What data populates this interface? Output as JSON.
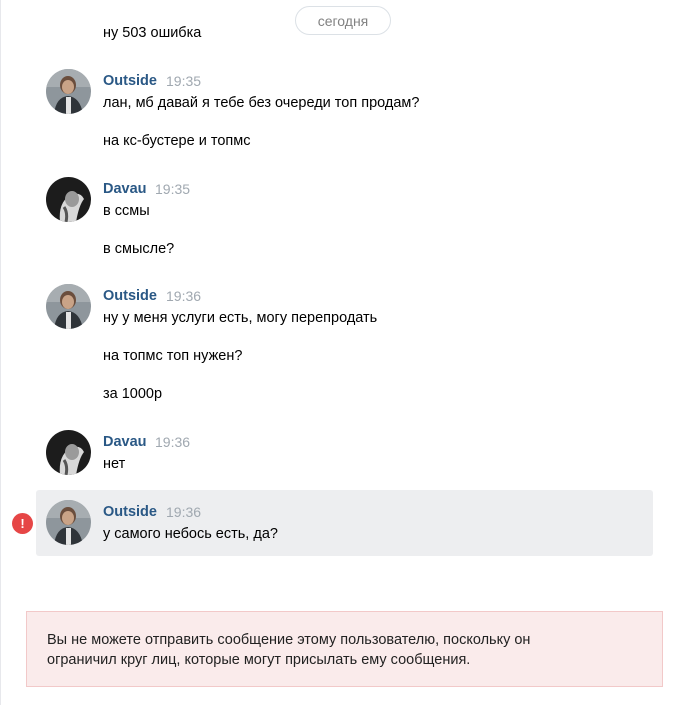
{
  "date_separator": "сегодня",
  "messages": [
    {
      "author": "",
      "time": "",
      "lines": [
        "ну 503 ошибка"
      ]
    },
    {
      "author": "Outside",
      "time": "19:35",
      "avatar": "outside-avatar",
      "lines": [
        "лан, мб давай я тебе без очереди топ продам?",
        "на кс-бустере и топмс"
      ]
    },
    {
      "author": "Davau",
      "time": "19:35",
      "avatar": "davau-avatar",
      "lines": [
        "в ссмы",
        "в смысле?"
      ]
    },
    {
      "author": "Outside",
      "time": "19:36",
      "avatar": "outside-avatar",
      "lines": [
        "ну у меня услуги есть, могу перепродать",
        "на топмс топ нужен?",
        "за 1000р"
      ]
    },
    {
      "author": "Davau",
      "time": "19:36",
      "avatar": "davau-avatar",
      "lines": [
        "нет"
      ]
    },
    {
      "author": "Outside",
      "time": "19:36",
      "avatar": "outside-avatar",
      "status": "failed",
      "lines": [
        "у самого небось есть, да?"
      ]
    }
  ],
  "notice": {
    "line1": "Вы не можете отправить сообщение этому пользователю, поскольку он",
    "line2": "ограничил круг лиц, которые могут присылать ему сообщения."
  },
  "colors": {
    "author": "#2a5885",
    "time": "#a0a8b0",
    "highlight": "#edeef0",
    "error": "#e64646",
    "notice_bg": "#faebeb",
    "notice_border": "#f2c9c9"
  }
}
